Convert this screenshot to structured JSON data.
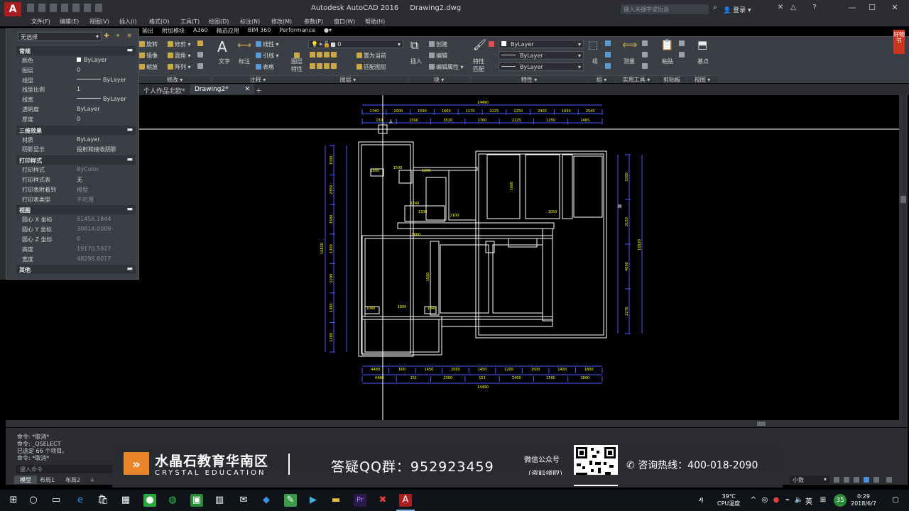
{
  "titlebar": {
    "app_title": "Autodesk AutoCAD 2016",
    "doc_title": "Drawing2.dwg",
    "search_placeholder": "键入关键字或短语",
    "login_label": "登录"
  },
  "menu": [
    "文件(F)",
    "编辑(E)",
    "视图(V)",
    "插入(I)",
    "格式(O)",
    "工具(T)",
    "绘图(D)",
    "标注(N)",
    "修改(M)",
    "参数(P)",
    "窗口(W)",
    "帮助(H)"
  ],
  "ribbon_tabs": [
    "输出",
    "附加模块",
    "A360",
    "精选应用",
    "BIM 360",
    "Performance"
  ],
  "ribbon": {
    "modify": {
      "rotate": "旋转",
      "trim": "修剪",
      "mirror": "镜像",
      "fillet": "圆角",
      "scale": "缩放",
      "array": "阵列",
      "footer": "修改"
    },
    "annotation": {
      "text": "文字",
      "dim": "标注",
      "linear": "线性",
      "leader": "引线",
      "table": "表格",
      "footer": "注释"
    },
    "layers": {
      "layer_value": "0",
      "set_current": "置为当前",
      "match_layer": "匹配图层",
      "layer_props_1": "图层",
      "layer_props_2": "特性",
      "footer": "图层"
    },
    "block": {
      "insert": "插入",
      "create": "创建",
      "edit": "编辑",
      "edit_attr": "编辑属性",
      "footer": "块"
    },
    "properties": {
      "match_1": "特性",
      "match_2": "匹配",
      "color": "ByLayer",
      "linetype": "ByLayer",
      "lineweight": "ByLayer",
      "footer": "特性"
    },
    "groups": {
      "group": "组",
      "footer": "组"
    },
    "utilities": {
      "measure": "测量",
      "footer": "实用工具"
    },
    "clipboard": {
      "paste": "粘贴",
      "footer": "剪贴板"
    },
    "view": {
      "base": "基点",
      "footer": "视图"
    },
    "side_banner": "好物节"
  },
  "doc_tabs": {
    "tab1": "个人作品北欧*",
    "tab2": "Drawing2*"
  },
  "properties_palette": {
    "selection": "无选择",
    "sections": [
      {
        "title": "常规",
        "rows": [
          {
            "k": "颜色",
            "v": "ByLayer",
            "kind": "swatch"
          },
          {
            "k": "图层",
            "v": "0"
          },
          {
            "k": "线型",
            "v": "ByLayer",
            "kind": "line"
          },
          {
            "k": "线型比例",
            "v": "1"
          },
          {
            "k": "线宽",
            "v": "ByLayer",
            "kind": "line"
          },
          {
            "k": "透明度",
            "v": "ByLayer"
          },
          {
            "k": "厚度",
            "v": "0"
          }
        ]
      },
      {
        "title": "三维效果",
        "rows": [
          {
            "k": "材质",
            "v": "ByLayer"
          },
          {
            "k": "阴影显示",
            "v": "投射和接收阴影"
          }
        ]
      },
      {
        "title": "打印样式",
        "rows": [
          {
            "k": "打印样式",
            "v": "ByColor",
            "kind": "dim"
          },
          {
            "k": "打印样式表",
            "v": "无"
          },
          {
            "k": "打印表附着到",
            "v": "模型",
            "kind": "dim"
          },
          {
            "k": "打印表类型",
            "v": "不可用",
            "kind": "dim"
          }
        ]
      },
      {
        "title": "视图",
        "rows": [
          {
            "k": "圆心 X 坐标",
            "v": "91456.1844",
            "kind": "dim"
          },
          {
            "k": "圆心 Y 坐标",
            "v": "30814.0089",
            "kind": "dim"
          },
          {
            "k": "圆心 Z 坐标",
            "v": "0",
            "kind": "dim"
          },
          {
            "k": "高度",
            "v": "19170.5927",
            "kind": "dim"
          },
          {
            "k": "宽度",
            "v": "48298.6017",
            "kind": "dim"
          }
        ]
      },
      {
        "title": "其他",
        "rows": []
      }
    ]
  },
  "drawing": {
    "dim_top_total": "14490",
    "dim_bottom_total": "14490",
    "dims_top_row1": [
      "1740",
      "1000",
      "1590",
      "1600",
      "1170",
      "2225",
      "1250",
      "2400",
      "1030",
      "2545"
    ],
    "dims_top_row2": [
      "150",
      "1590",
      "3520",
      "1760",
      "2225",
      "1250",
      "1465"
    ],
    "dims_bottom_row1": [
      "4480",
      "600",
      "1450",
      "2000",
      "1450",
      "1200",
      "1500",
      "1400",
      "1800"
    ],
    "dims_bottom_row2": [
      "4480",
      "151",
      "2300",
      "151",
      "2400",
      "1500",
      "1800"
    ],
    "dim_left_total": "16820",
    "dim_right_total": "16820",
    "dims_left": [
      "1500",
      "2350",
      "1580",
      "1300",
      "2200",
      "1380",
      "1280"
    ],
    "dims_right": [
      "3200",
      "2150",
      "4000",
      "2270"
    ],
    "room_labels": [
      "1600",
      "1500",
      "1200",
      "1240",
      "1300",
      "2100",
      "1600",
      "1050",
      "1600",
      "1560",
      "1040",
      "2000",
      "1040"
    ]
  },
  "command": {
    "lines": [
      "命令: *取消*",
      "命令:  _QSELECT",
      "已选定 66 个项目。",
      "命令: *取消*"
    ],
    "input_placeholder": "键入命令"
  },
  "banner": {
    "name": "水晶石教育华南区",
    "sub": "CRYSTAL EDUCATION",
    "qq": "答疑QQ群：952923459",
    "wechat_1": "微信公众号",
    "wechat_2": "（资料领取）",
    "phone": "咨询热线：400-018-2090"
  },
  "status": {
    "tabs": [
      "模型",
      "布局1",
      "布局2"
    ],
    "units": "小数"
  },
  "taskbar": {
    "weather_1": "39℃",
    "weather_2": "CPU温度",
    "lang": "英",
    "time": "0:29",
    "date": "2018/6/7"
  },
  "colors": {
    "accent_red": "#a81d1d",
    "wall": "#ffffff",
    "dimension": "#ffff00",
    "dim_line": "#4a5aff"
  }
}
